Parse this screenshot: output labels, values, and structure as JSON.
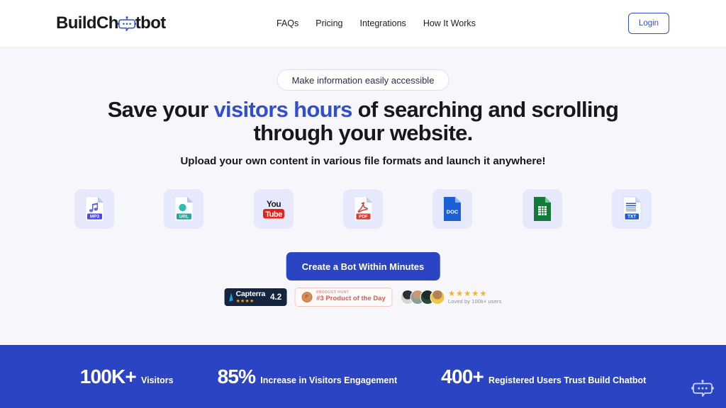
{
  "header": {
    "logo_text_before": "BuildCh",
    "logo_icon": "chatbot-robot-icon",
    "logo_text_after": "tbot",
    "nav": [
      {
        "label": "FAQs"
      },
      {
        "label": "Pricing"
      },
      {
        "label": "Integrations"
      },
      {
        "label": "How It Works"
      }
    ],
    "login_label": "Login"
  },
  "hero": {
    "eyebrow": "Make information easily accessible",
    "headline_part1": "Save your ",
    "headline_highlight": "visitors hours",
    "headline_part2": " of searching and scrolling through your website.",
    "subheadline": "Upload your own content in various file formats and launch it anywhere!",
    "cta_label": "Create a Bot Within Minutes",
    "formats": [
      {
        "label": "MP3",
        "icon": "mp3-file-icon",
        "color": "#4b4fd6"
      },
      {
        "label": "URL",
        "icon": "url-file-icon",
        "color": "#20a99a"
      },
      {
        "label": "YouTube",
        "icon": "youtube-icon",
        "color": "#e62117"
      },
      {
        "label": "PDF",
        "icon": "pdf-file-icon",
        "color": "#d83b34"
      },
      {
        "label": "DOC",
        "icon": "doc-file-icon",
        "color": "#1c60d8"
      },
      {
        "label": "Sheets",
        "icon": "sheets-file-icon",
        "color": "#137a3a"
      },
      {
        "label": "TXT",
        "icon": "txt-file-icon",
        "color": "#1f5fc4"
      }
    ]
  },
  "proof": {
    "capterra": {
      "name": "Capterra",
      "stars": "★★★★",
      "score": "4.2"
    },
    "product_hunt": {
      "eyebrow": "PRODUCT HUNT",
      "title": "#3 Product of the Day",
      "icon": "product-hunt-medal-icon"
    },
    "loved": {
      "stars": "★★★★★",
      "caption": "Loved by 100k+ users"
    }
  },
  "stats": [
    {
      "number": "100K+",
      "label": "Visitors"
    },
    {
      "number": "85%",
      "label": "Increase in Visitors Engagement"
    },
    {
      "number": "400+",
      "label": "Registered Users Trust Build Chatbot"
    }
  ],
  "chat_widget": {
    "icon": "chatbot-launcher-icon"
  },
  "colors": {
    "brand_blue": "#2a44c4",
    "link_blue": "#2f4fd0",
    "page_bg": "#f6f6fb",
    "tile_bg": "#e6e9fb"
  }
}
